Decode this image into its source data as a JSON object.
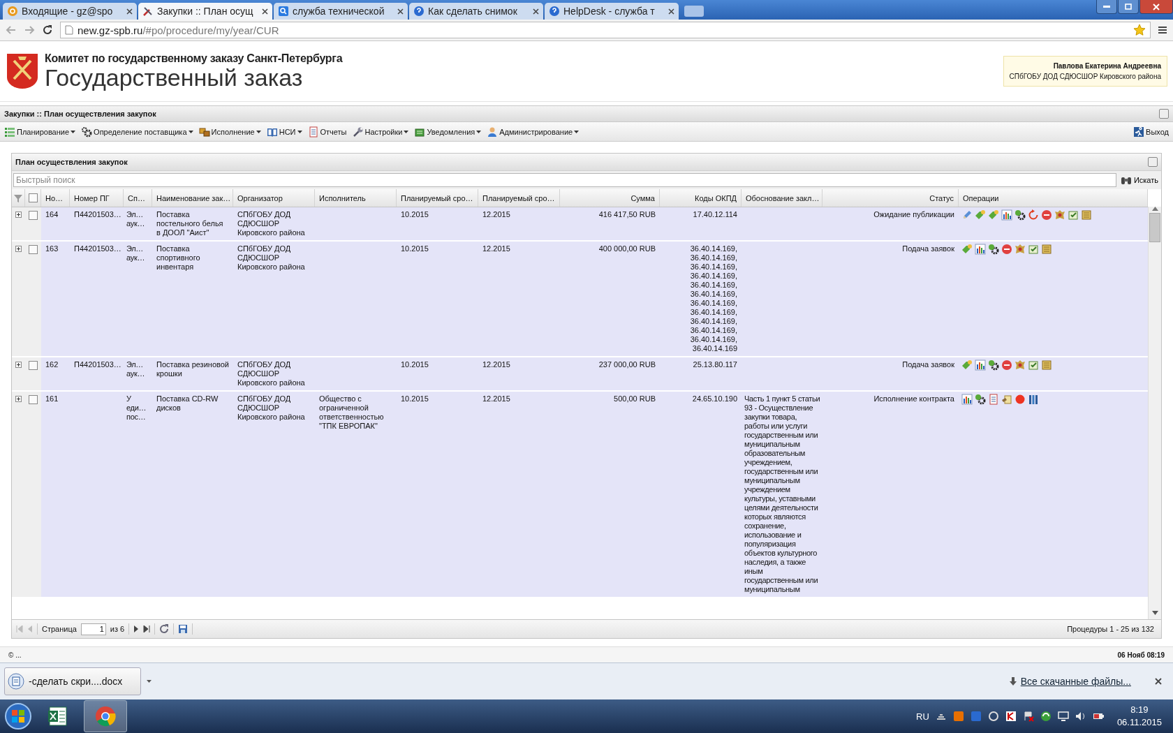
{
  "browser": {
    "tabs": [
      {
        "title": "Входящие - gz@spo",
        "kind": "mail",
        "selected": false
      },
      {
        "title": "Закупки :: План осущ",
        "kind": "tools",
        "selected": true
      },
      {
        "title": "служба технической",
        "kind": "search",
        "selected": false
      },
      {
        "title": "Как сделать снимок",
        "kind": "help",
        "selected": false
      },
      {
        "title": "HelpDesk - служба т",
        "kind": "help",
        "selected": false
      }
    ],
    "url": {
      "host": "new.gz-spb.ru",
      "path": "/#po/procedure/my/year/CUR"
    },
    "starred": true
  },
  "header": {
    "committee": "Комитет по государственному заказу Санкт-Петербурга",
    "title": "Государственный заказ",
    "user": {
      "name": "Павлова Екатерина Андреевна",
      "org": "СПбГОБУ ДОД СДЮСШОР Кировского района"
    }
  },
  "module": {
    "title": "Закупки :: План осуществления закупок"
  },
  "menu": [
    {
      "label": "Планирование",
      "kind": "list",
      "dropdown": true
    },
    {
      "label": "Определение поставщика",
      "kind": "gears",
      "dropdown": true
    },
    {
      "label": "Исполнение",
      "kind": "boxes",
      "dropdown": true
    },
    {
      "label": "НСИ",
      "kind": "book",
      "dropdown": true
    },
    {
      "label": "Отчеты",
      "kind": "report",
      "dropdown": false
    },
    {
      "label": "Настройки",
      "kind": "wrench",
      "dropdown": true
    },
    {
      "label": "Уведомления",
      "kind": "tray",
      "dropdown": true
    },
    {
      "label": "Администрирование",
      "kind": "user",
      "dropdown": true
    }
  ],
  "logout": "Выход",
  "panel": {
    "title": "План осуществления закупок",
    "all_checked": false,
    "search": {
      "placeholder": "Быстрый поиск",
      "button": "Искать"
    },
    "columns": [
      "Но…",
      "Номер ПГ",
      "Сп…",
      "Наименование зак…",
      "Организатор",
      "Исполнитель",
      "Планируемый сро…",
      "Планируемый сро…",
      "Сумма",
      "Коды ОКПД",
      "Обоснование закл…",
      "Статус",
      "Операции"
    ],
    "rows": [
      {
        "expanded": false,
        "checked": false,
        "cells": [
          "164",
          "П44201503…",
          "Эл… аук…",
          "Поставка постельного белья в ДООЛ \"Аист\"",
          "СПбГОБУ ДОД СДЮСШОР Кировского района",
          "",
          "10.2015",
          "12.2015",
          "416 417,50 RUB",
          "17.40.12.114",
          "",
          "Ожидание публикации"
        ],
        "operations": [
          {
            "kind": "pencil"
          },
          {
            "kind": "tag"
          },
          {
            "kind": "tag"
          },
          {
            "kind": "chart"
          },
          {
            "kind": "gear"
          },
          {
            "kind": "refresh"
          },
          {
            "kind": "stop"
          },
          {
            "kind": "emblem"
          },
          {
            "kind": "note"
          },
          {
            "kind": "scroll"
          }
        ]
      },
      {
        "expanded": false,
        "checked": false,
        "cells": [
          "163",
          "П44201503…",
          "Эл… аук…",
          "Поставка спортивного инвентаря",
          "СПбГОБУ ДОД СДЮСШОР Кировского района",
          "",
          "10.2015",
          "12.2015",
          "400 000,00 RUB",
          "36.40.14.169, 36.40.14.169, 36.40.14.169, 36.40.14.169, 36.40.14.169, 36.40.14.169, 36.40.14.169, 36.40.14.169, 36.40.14.169, 36.40.14.169, 36.40.14.169, 36.40.14.169",
          "",
          "Подача заявок"
        ],
        "operations": [
          {
            "kind": "tag"
          },
          {
            "kind": "chart"
          },
          {
            "kind": "gear"
          },
          {
            "kind": "stop"
          },
          {
            "kind": "emblem"
          },
          {
            "kind": "note"
          },
          {
            "kind": "scroll"
          }
        ]
      },
      {
        "expanded": false,
        "checked": false,
        "cells": [
          "162",
          "П44201503…",
          "Эл… аук…",
          "Поставка резиновой крошки",
          "СПбГОБУ ДОД СДЮСШОР Кировского района",
          "",
          "10.2015",
          "12.2015",
          "237 000,00 RUB",
          "25.13.80.117",
          "",
          "Подача заявок"
        ],
        "operations": [
          {
            "kind": "tag"
          },
          {
            "kind": "chart"
          },
          {
            "kind": "gear"
          },
          {
            "kind": "stop"
          },
          {
            "kind": "emblem"
          },
          {
            "kind": "note"
          },
          {
            "kind": "scroll"
          }
        ]
      },
      {
        "expanded": false,
        "checked": false,
        "cells": [
          "161",
          "",
          "У еди… пос…",
          "Поставка CD-RW дисков",
          "СПбГОБУ ДОД СДЮСШОР Кировского района",
          "Общество с ограниченной ответственностью \"ТПК ЕВРОПАК\"",
          "10.2015",
          "12.2015",
          "500,00 RUB",
          "24.65.10.190",
          "Часть 1 пункт 5 статьи 93 - Осуществление закупки товара, работы или услуги государственным или муниципальным образовательным учреждением, государственным или муниципальным учреждением культуры, уставными целями деятельности которых являются сохранение, использование и популяризация объектов культурного наследия, а также иным государственным или муниципальным",
          "Исполнение контракта"
        ],
        "operations": [
          {
            "kind": "chart"
          },
          {
            "kind": "gear"
          },
          {
            "kind": "document"
          },
          {
            "kind": "paper"
          },
          {
            "kind": "dot"
          },
          {
            "kind": "binders"
          }
        ]
      }
    ],
    "pager": {
      "page_label": "Страница",
      "page": "1",
      "of": "из 6",
      "summary": "Процедуры 1 - 25 из 132"
    }
  },
  "footer": {
    "left": "© ...",
    "right": "06 Нояб 08:19"
  },
  "downloads": {
    "file": "-сделать скри....docx",
    "all": "Все скачанные файлы..."
  },
  "taskbar": {
    "apps": [
      {
        "kind": "excel",
        "selected": false
      },
      {
        "kind": "chrome",
        "selected": true
      }
    ],
    "lang": "RU",
    "time": "8:19",
    "date": "06.11.2015"
  }
}
